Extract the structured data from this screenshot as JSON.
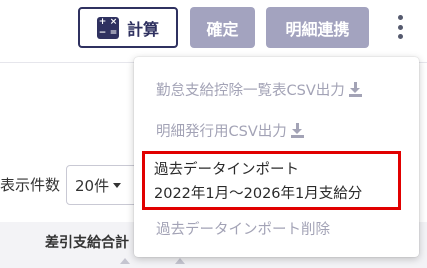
{
  "toolbar": {
    "calc_label": "計算",
    "calc_icon_symbols": [
      "+",
      "×",
      "−",
      "="
    ],
    "confirm_label": "確定",
    "link_label": "明細連携"
  },
  "list": {
    "page_count_label": "表示件数",
    "page_count_value": "20件",
    "column_header": "差引支給合計"
  },
  "menu": {
    "items": [
      {
        "label": "勤怠支給控除一覧表CSV出力",
        "icon": "download-icon",
        "enabled": false
      },
      {
        "label": "明細発行用CSV出力",
        "icon": "download-icon",
        "enabled": false
      },
      {
        "label_line1": "過去データインポート",
        "label_line2": "2022年1月〜2026年1月支給分",
        "enabled": true,
        "highlighted": true
      },
      {
        "label": "過去データインポート削除",
        "enabled": false
      }
    ]
  },
  "colors": {
    "navy": "#2f3160",
    "disabled_button": "#a3a3bf",
    "highlight_border": "#e10000",
    "disabled_text": "#a3a3b6"
  }
}
